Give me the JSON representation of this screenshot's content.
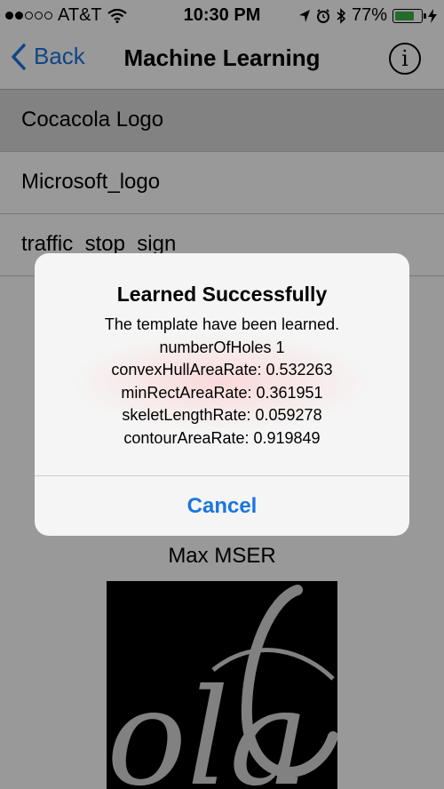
{
  "status_bar": {
    "carrier": "AT&T",
    "time": "10:30 PM",
    "battery_percent": "77%",
    "battery_level": 0.77,
    "signal_bars": 2,
    "signal_total": 5,
    "icons": [
      "wifi-icon",
      "location-icon",
      "alarm-icon",
      "bluetooth-icon",
      "battery-icon",
      "charging-icon"
    ],
    "battery_color": "#3cb44a"
  },
  "nav": {
    "back_label": "Back",
    "title": "Machine Learning",
    "info_label": "i",
    "accent_color": "#1a75e0"
  },
  "list": {
    "items": [
      {
        "label": "Cocacola Logo",
        "selected": true
      },
      {
        "label": "Microsoft_logo",
        "selected": false
      },
      {
        "label": "traffic_stop_sign",
        "selected": false
      }
    ]
  },
  "mser": {
    "label": "Max MSER",
    "image_text": "ola"
  },
  "alert": {
    "title": "Learned Successfully",
    "lines": [
      "The template have been learned.",
      "numberOfHoles 1",
      "convexHullAreaRate: 0.532263",
      "minRectAreaRate: 0.361951",
      "skeletLengthRate: 0.059278",
      "contourAreaRate: 0.919849"
    ],
    "cancel_label": "Cancel"
  }
}
